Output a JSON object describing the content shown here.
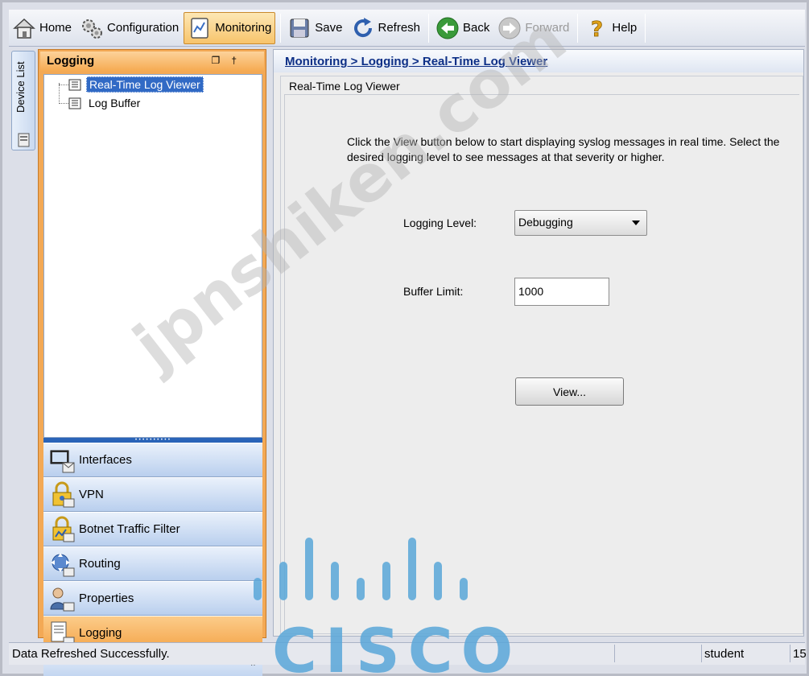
{
  "toolbar": {
    "home": "Home",
    "configuration": "Configuration",
    "monitoring": "Monitoring",
    "save": "Save",
    "refresh": "Refresh",
    "back": "Back",
    "forward": "Forward",
    "help": "Help"
  },
  "device_tab": {
    "label": "Device List"
  },
  "left_panel": {
    "title": "Logging",
    "tree": [
      {
        "label": "Real-Time Log Viewer",
        "selected": true
      },
      {
        "label": "Log Buffer",
        "selected": false
      }
    ],
    "nav": [
      {
        "label": "Interfaces",
        "icon": "interfaces-icon"
      },
      {
        "label": "VPN",
        "icon": "vpn-icon"
      },
      {
        "label": "Botnet Traffic Filter",
        "icon": "botnet-icon"
      },
      {
        "label": "Routing",
        "icon": "routing-icon"
      },
      {
        "label": "Properties",
        "icon": "properties-icon"
      },
      {
        "label": "Logging",
        "icon": "logging-icon",
        "active": true
      }
    ],
    "more": "»"
  },
  "breadcrumb": {
    "part1": "Monitoring",
    "sep": " > ",
    "part2": "Logging",
    "part3": "Real-Time Log Viewer"
  },
  "content": {
    "group_title": "Real-Time Log Viewer",
    "desc_line1": "Click the View button below to start displaying syslog messages in real time. Select the",
    "desc_line2": "desired logging level to see messages at that severity or higher.",
    "logging_level_label": "Logging Level:",
    "logging_level_value": "Debugging",
    "buffer_limit_label": "Buffer Limit:",
    "buffer_limit_value": "1000",
    "view_button": "View..."
  },
  "status": {
    "message": "Data Refreshed Successfully.",
    "user": "student",
    "extra": "15"
  },
  "watermark": "jpnshiken.com",
  "logo_text": "CISCO",
  "colors": {
    "accent_orange": "#f4a54a",
    "nav_blue": "#b9cfee",
    "selection_blue": "#316ac5",
    "cisco_blue": "#5aa7d9"
  }
}
